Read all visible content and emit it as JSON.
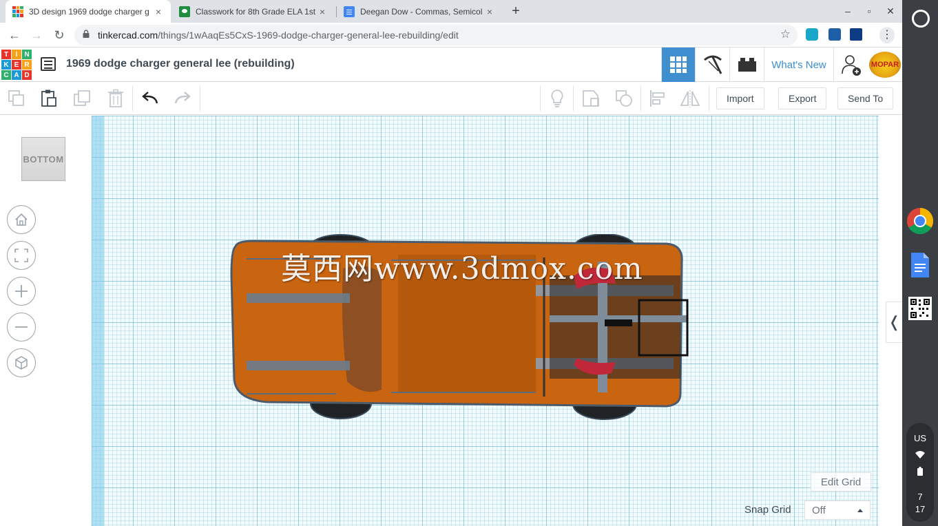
{
  "browser": {
    "tabs": [
      {
        "title": "3D design 1969 dodge charger g",
        "active": true
      },
      {
        "title": "Classwork for 8th Grade ELA 1st",
        "active": false
      },
      {
        "title": "Deegan Dow - Commas, Semicol",
        "active": false
      }
    ],
    "tab_close_glyph": "×",
    "new_tab_glyph": "+",
    "window_controls": {
      "minimize": "–",
      "maximize": "▫",
      "close": "✕"
    },
    "url_host": "tinkercad.com",
    "url_path": "/things/1wAaqEs5CxS-1969-dodge-charger-general-lee-rebuilding/edit",
    "nav": {
      "back": "←",
      "forward": "→",
      "reload": "↻",
      "star": "☆",
      "menu": "⋮"
    }
  },
  "tinkercad": {
    "logo_letters": [
      "TIN",
      "KER",
      "CAD"
    ],
    "design_title": "1969 dodge charger general lee (rebuilding)",
    "whats_new": "What's New",
    "avatar_text": "MOPAR",
    "toolbar": {
      "import": "Import",
      "export": "Export",
      "send_to": "Send To"
    },
    "viewcube_face": "BOTTOM",
    "edit_grid": "Edit Grid",
    "snap_grid_label": "Snap Grid",
    "snap_grid_value": "Off",
    "collapse_glyph": "❬",
    "watermark": "莫西网www.3dmox.com"
  },
  "shelf": {
    "locale": "US",
    "time_hour": "7",
    "time_minute": "17"
  },
  "colors": {
    "tinkercad_blue": "#3e8ed0",
    "car_orange": "#c96410",
    "chrome_tab_bg": "#dee1e6",
    "shelf_bg": "#3b3e42"
  }
}
